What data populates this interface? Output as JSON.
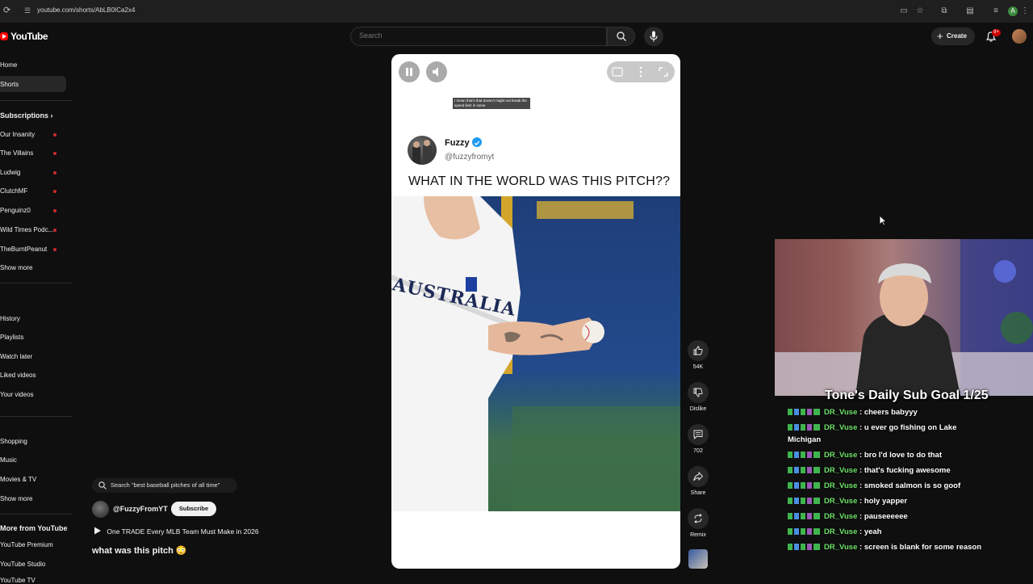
{
  "browser": {
    "url": "youtube.com/shorts/AbLB0ICa2x4"
  },
  "masthead": {
    "logo_text": "YouTube",
    "search_placeholder": "Search",
    "create_label": "Create",
    "notification_count": "9+"
  },
  "sidebar": {
    "home": "Home",
    "shorts": "Shorts",
    "subscriptions_header": "Subscriptions",
    "subscriptions": [
      "Our Insanity",
      "The Villains",
      "Ludwig",
      "ClutchMF",
      "Penguinz0",
      "Wild Times Podc...",
      "TheBurntPeanut"
    ],
    "show_more_1": "Show more",
    "you_items": [
      "History",
      "Playlists",
      "Watch later",
      "Liked videos",
      "Your videos"
    ],
    "explore_items": [
      "Shopping",
      "Music",
      "Movies & TV"
    ],
    "show_more_2": "Show more",
    "more_header": "More from YouTube",
    "more_items": [
      "YouTube Premium",
      "YouTube Studio",
      "YouTube TV"
    ]
  },
  "short": {
    "caption_text": "I mean that's that doesn't might not break the speed limit in some",
    "tweet_name": "Fuzzy",
    "tweet_handle": "@fuzzyfromyt",
    "tweet_text": "WHAT IN THE WORLD WAS THIS PITCH??",
    "jersey_text": "AUSTRALIA"
  },
  "actions": {
    "likes": "54K",
    "dislike_label": "Dislike",
    "comments": "702",
    "share_label": "Share",
    "remix_label": "Remix"
  },
  "info": {
    "related_search": "Search \"best baseball pitches of all time\"",
    "channel_name": "@FuzzyFromYT",
    "subscribe_label": "Subscribe",
    "playlist_text": "One TRADE Every MLB Team Must Make in 2026",
    "title": "what was this pitch 😳"
  },
  "overlay": {
    "goal_text": "Tone's Daily Sub Goal 1/25",
    "chat": [
      {
        "user": "DR_Vuse",
        "msg": "cheers babyyy"
      },
      {
        "user": "DR_Vuse",
        "msg": "u ever go fishing on Lake Michigan"
      },
      {
        "user": "DR_Vuse",
        "msg": "bro I'd love to do that"
      },
      {
        "user": "DR_Vuse",
        "msg": "that's fucking awesome"
      },
      {
        "user": "DR_Vuse",
        "msg": "smoked salmon is so goof"
      },
      {
        "user": "DR_Vuse",
        "msg": "holy yapper"
      },
      {
        "user": "DR_Vuse",
        "msg": "pauseeeeee"
      },
      {
        "user": "DR_Vuse",
        "msg": "yeah"
      },
      {
        "user": "DR_Vuse",
        "msg": "screen is blank for some reason"
      }
    ]
  }
}
